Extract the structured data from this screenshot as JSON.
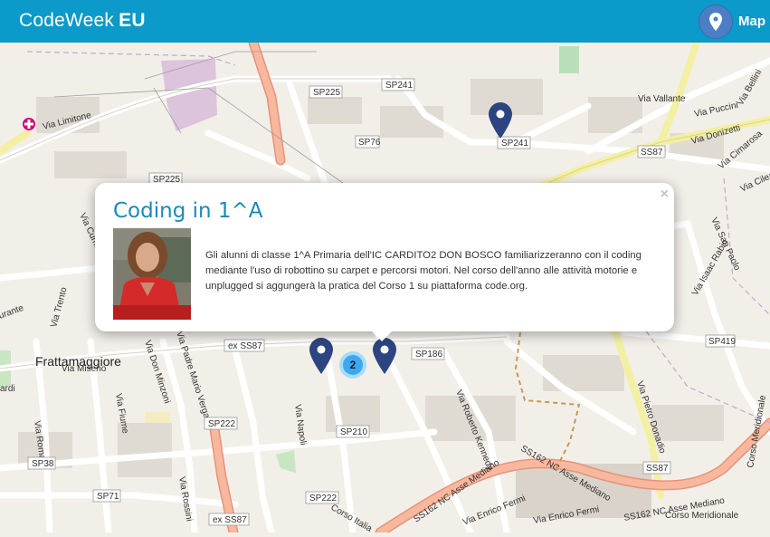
{
  "header": {
    "brand_light": "CodeWeek",
    "brand_bold": "EU",
    "map_label": "Map",
    "map_icon": "map-marker-icon",
    "color": "#0b9ac9"
  },
  "map": {
    "place_name": "Frattamaggiore",
    "road_labels": [
      "SP225",
      "SP241",
      "SP241",
      "Via Limitone",
      "SP76",
      "SS87",
      "Via Vallante",
      "Via Puccini",
      "Via Donizetti",
      "Via Cimarosa",
      "Via Bellini",
      "Via Cilea",
      "SP225",
      "Via Cumana",
      "Via San Paolo",
      "Via Isaac Rabin",
      "SP419",
      "ex SS87",
      "SP186",
      "Via Trento",
      "Via Miseno",
      "Via Don Minzoni",
      "Via Padre Mario Vergara",
      "Via Napoli",
      "Via Roberto Kennedy",
      "Via Pietro Donadio",
      "SP222",
      "SP210",
      "Via Fiume",
      "Via Roma",
      "SP38",
      "SP71",
      "SP222",
      "SS162 NC Asse Mediano",
      "SS162 NC Asse Mediano",
      "SS162 NC Asse Mediano",
      "SS87",
      "Via Enrico Fermi",
      "Via Enrico Fermi",
      "Corso Italia",
      "ex SS87",
      "Via Rossini",
      "Corso Meridionale",
      "Corso Meridionale",
      "urante",
      "ardi"
    ]
  },
  "popup": {
    "title": "Coding in 1^A",
    "close": "×",
    "description": "Gli alunni di classe 1^A Primaria dell'IC CARDITO2 DON BOSCO familiarizzeranno con il coding mediante l'uso di robottino su carpet e percorsi motori. Nel corso dell'anno alle attività motorie e unplugged si aggungerà la pratica del Corso 1 su piattaforma code.org."
  },
  "cluster": {
    "count": "2"
  },
  "markers": [
    {
      "name": "event-marker"
    },
    {
      "name": "event-marker"
    },
    {
      "name": "event-marker"
    }
  ]
}
